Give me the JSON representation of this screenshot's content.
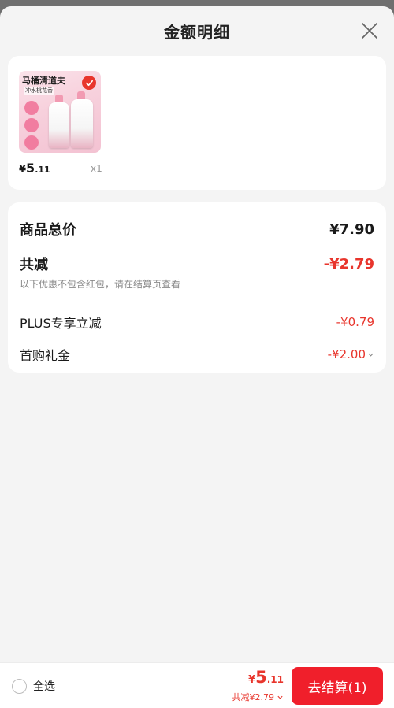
{
  "header": {
    "title": "金额明细"
  },
  "product": {
    "thumb_brand": "马桶清道夫",
    "thumb_sub": "冲水桃花香",
    "price_currency": "¥",
    "price_int": "5",
    "price_dec": ".11",
    "quantity": "x1"
  },
  "summary": {
    "total_label": "商品总价",
    "total_value": "¥7.90",
    "reduce_label": "共减",
    "reduce_value": "-¥2.79",
    "reduce_note": "以下优惠不包含红包，请在结算页查看",
    "items": [
      {
        "label": "PLUS专享立减",
        "value": "-¥0.79"
      },
      {
        "label": "首购礼金",
        "value": "-¥2.00"
      }
    ]
  },
  "bottom": {
    "select_all_label": "全选",
    "total_currency": "¥",
    "total_int": "5",
    "total_dec": ".11",
    "saved_text": "共减¥2.79",
    "checkout_label": "去结算(1)"
  },
  "colors": {
    "accent": "#e8352c",
    "button": "#f01f2b",
    "background": "#f4f4f4"
  }
}
